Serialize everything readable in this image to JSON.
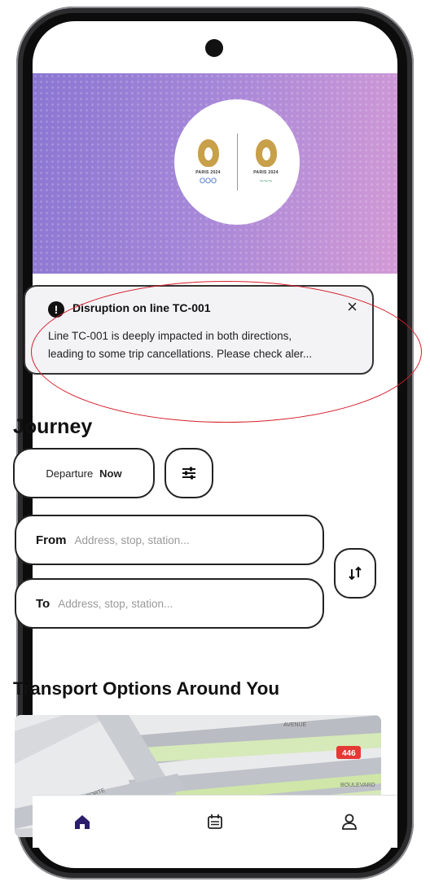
{
  "hero": {
    "logo_left": {
      "text": "PARIS 2024",
      "rings": "OOO"
    },
    "logo_right": {
      "text": "PARIS 2024",
      "agitos": "~~~"
    }
  },
  "alert": {
    "icon": "exclamation-icon",
    "title": "Disruption on line TC-001",
    "body_line1": "Line TC-001 is deeply impacted in both directions,",
    "body_line2": "leading to some trip cancellations. Please check aler...",
    "close_label": "×"
  },
  "journey": {
    "title": "Journey",
    "departure_label": "Departure",
    "departure_value": "Now",
    "filter_icon": "sliders-icon",
    "from_label": "From",
    "from_placeholder": "Address, stop, station...",
    "to_label": "To",
    "to_placeholder": "Address, stop, station...",
    "swap_icon": "swap-arrows-icon"
  },
  "transport": {
    "title": "Transport Options Around You",
    "map_badge": "446",
    "street_1": "AVENUE",
    "street_2": "BOULEVARD",
    "street_3": "AVENUE DE LA PORTE"
  },
  "bottom_nav": {
    "items": [
      {
        "icon": "home-icon",
        "active": true
      },
      {
        "icon": "calendar-icon",
        "active": false
      },
      {
        "icon": "profile-icon",
        "active": false
      }
    ]
  },
  "colors": {
    "accent": "#2b1d6b",
    "hero_start": "#8a76d2",
    "hero_end": "#d39ad6",
    "alert_bg": "#f3f3f6",
    "highlight": "#d61e2a",
    "map_badge": "#e53935"
  }
}
